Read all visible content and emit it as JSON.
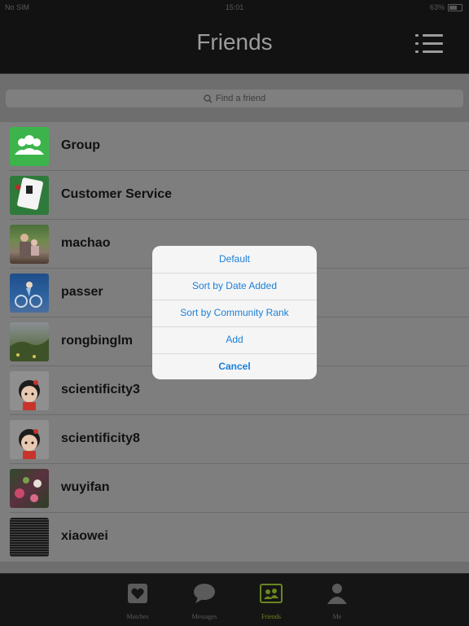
{
  "status_bar": {
    "carrier": "No SIM",
    "time": "15:01",
    "battery": "63%"
  },
  "nav": {
    "title": "Friends",
    "menu_icon": "list-icon"
  },
  "search": {
    "placeholder": "Find a friend",
    "icon": "search-icon"
  },
  "friends": [
    {
      "name": "Group",
      "avatar": "group-icon"
    },
    {
      "name": "Customer Service",
      "avatar": "cards-logo"
    },
    {
      "name": "machao",
      "avatar": "photo"
    },
    {
      "name": "passer",
      "avatar": "photo"
    },
    {
      "name": "rongbinglm",
      "avatar": "photo"
    },
    {
      "name": "scientificity3",
      "avatar": "cartoon-girl"
    },
    {
      "name": "scientificity8",
      "avatar": "cartoon-girl"
    },
    {
      "name": "wuyifan",
      "avatar": "photo"
    },
    {
      "name": "xiaowei",
      "avatar": "photo"
    }
  ],
  "action_sheet": {
    "items": [
      "Default",
      "Sort by Date Added",
      "Sort by Community Rank",
      "Add"
    ],
    "cancel": "Cancel"
  },
  "tabs": [
    {
      "label": "Matches",
      "icon": "heart-icon",
      "active": false
    },
    {
      "label": "Messages",
      "icon": "chat-bubble-icon",
      "active": false
    },
    {
      "label": "Friends",
      "icon": "contacts-icon",
      "active": true
    },
    {
      "label": "Me",
      "icon": "person-icon",
      "active": false
    }
  ],
  "colors": {
    "accent_blue": "#1a7fd8",
    "active_tab": "#6a8620",
    "group_green": "#3cb44b"
  }
}
